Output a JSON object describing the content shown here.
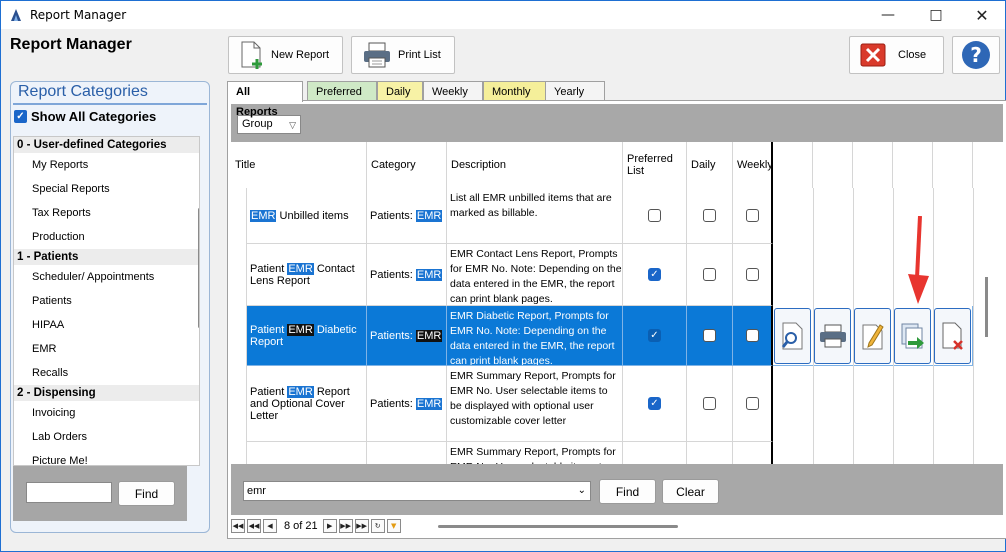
{
  "window": {
    "title": "Report Manager"
  },
  "header": {
    "title": "Report Manager"
  },
  "toolbar": {
    "new_report": "New Report",
    "print_list": "Print List",
    "close": "Close"
  },
  "categories": {
    "title": "Report Categories",
    "show_all": "Show All Categories",
    "groups": [
      {
        "label": "0 - User-defined Categories",
        "items": [
          "My Reports",
          "Special Reports",
          "Tax Reports",
          "Production"
        ]
      },
      {
        "label": "1 - Patients",
        "items": [
          "Scheduler/ Appointments",
          "Patients",
          "HIPAA",
          "EMR",
          "Recalls"
        ]
      },
      {
        "label": "2 - Dispensing",
        "items": [
          "Invoicing",
          "Lab Orders",
          "Picture Me!"
        ]
      }
    ],
    "find_button": "Find"
  },
  "tabs": [
    "All Reports",
    "Preferred",
    "Daily",
    "Weekly",
    "Monthly",
    "Yearly"
  ],
  "group_by": "Group",
  "columns": {
    "title": "Title",
    "category": "Category",
    "description": "Description",
    "preferred": "Preferred List",
    "daily": "Daily",
    "weekly": "Weekly"
  },
  "rows": [
    {
      "title_pre": "",
      "title_hl": "EMR",
      "title_post": " Unbilled items",
      "cat_pre": "Patients: ",
      "cat_hl": "EMR",
      "description": "List all EMR unbilled items that are marked as billable.",
      "preferred": false,
      "daily": false,
      "weekly": false
    },
    {
      "title_pre": "Patient ",
      "title_hl": "EMR",
      "title_post": " Contact Lens Report",
      "cat_pre": "Patients: ",
      "cat_hl": "EMR",
      "description": "EMR Contact Lens Report, Prompts for EMR No.  Note: Depending on the data entered in the EMR, the report can print blank pages.",
      "preferred": true,
      "daily": false,
      "weekly": false
    },
    {
      "title_pre": "Patient ",
      "title_hl": "EMR",
      "title_post": " Diabetic Report",
      "cat_pre": "Patients: ",
      "cat_hl": "EMR",
      "description": "EMR Diabetic Report, Prompts for EMR No.  Note: Depending on the data entered in the EMR, the report can print blank pages.",
      "preferred": true,
      "daily": false,
      "weekly": false
    },
    {
      "title_pre": "Patient ",
      "title_hl": "EMR",
      "title_post": " Report and Optional Cover Letter",
      "cat_pre": "Patients: ",
      "cat_hl": "EMR",
      "description": "EMR Summary Report, Prompts for EMR No.  User selectable items to be displayed with optional user customizable cover letter",
      "preferred": true,
      "daily": false,
      "weekly": false
    },
    {
      "title_pre": "",
      "title_hl": "",
      "title_post": "",
      "cat_pre": "",
      "cat_hl": "",
      "description": "EMR Summary Report, Prompts for EMR No.  User selectable items to",
      "preferred": false,
      "daily": false,
      "weekly": false
    }
  ],
  "search": {
    "value": "emr",
    "find": "Find",
    "clear": "Clear"
  },
  "pager": {
    "text": "8 of 21"
  },
  "colors": {
    "accent": "#1a74d2",
    "selected_row": "#0b79d7",
    "arrow": "#e8352f"
  }
}
